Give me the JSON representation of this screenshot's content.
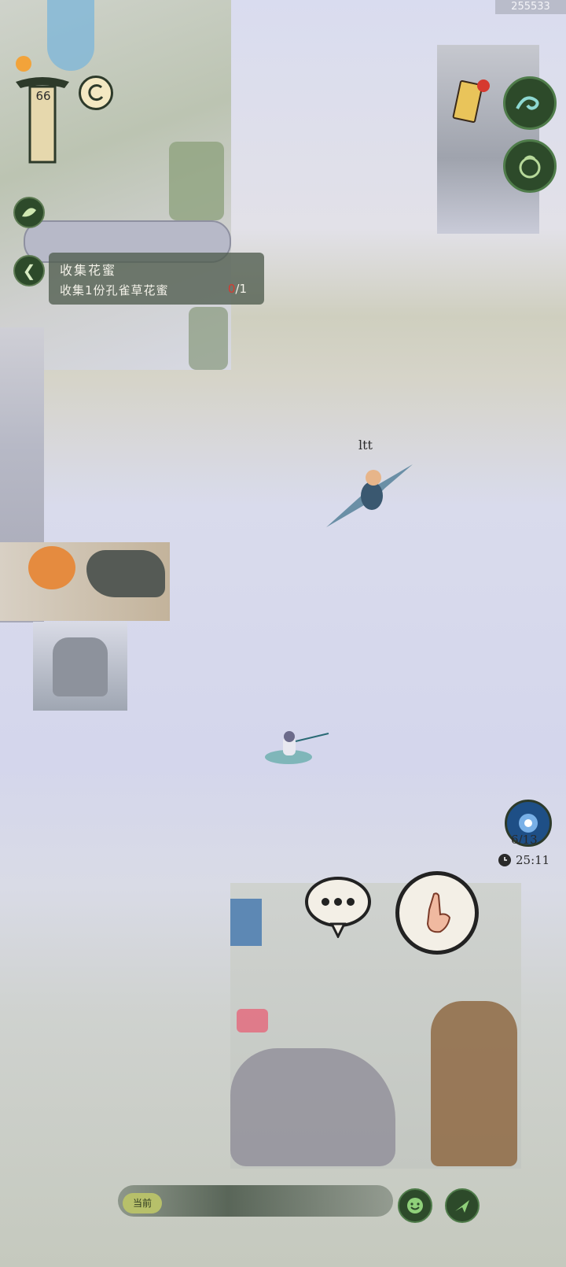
{
  "watermark": "255533",
  "player": {
    "level": "66"
  },
  "quest": {
    "title": "收集花蜜",
    "description": "收集1份孔雀草花蜜",
    "progress_current": "0",
    "progress_total": "/1"
  },
  "other_player": {
    "name": "ltt"
  },
  "energy": {
    "value": "6/13"
  },
  "timer": {
    "value": "25:11"
  },
  "chat": {
    "channel_label": "当前"
  },
  "icons": {
    "top_left_badge": "orange-dot-icon",
    "sign": "wooden-signpost-icon",
    "swirl": "spiral-coin-icon",
    "leaf": "leaf-icon",
    "back": "chevron-left-icon",
    "scroll": "quest-scroll-icon",
    "wave": "wave-icon",
    "pouch": "pouch-icon",
    "portal": "portal-icon",
    "clock": "clock-icon",
    "speech": "speech-bubble-icon",
    "hand": "hand-gesture-icon",
    "emoji": "emoji-icon",
    "send": "send-icon"
  },
  "colors": {
    "accent_green": "#3f7a3c",
    "dark_green": "#2d4a2a",
    "quest_bg": "#505c4e",
    "alert_red": "#d6392f"
  }
}
